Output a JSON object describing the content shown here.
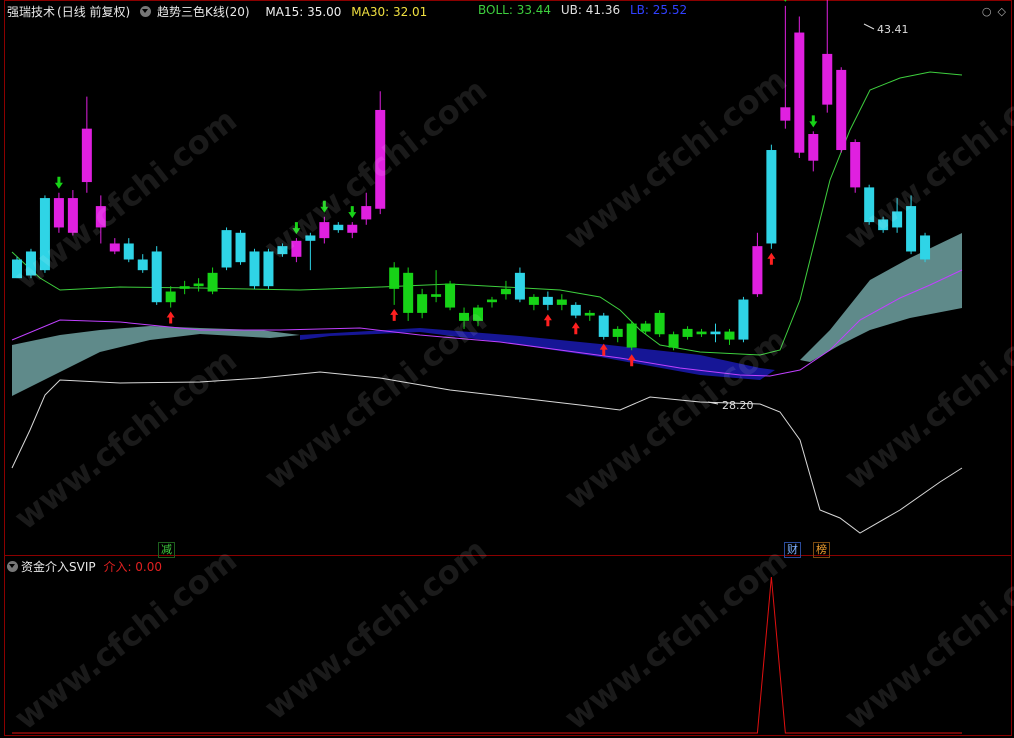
{
  "header": {
    "title": "强瑞技术",
    "period": "(日线 前复权)",
    "indicator": "趋势三色K线(20)",
    "ma15_label": "MA15: 35.00",
    "ma30_label": "MA30: 32.01"
  },
  "boll": {
    "boll_label": "BOLL: 33.44",
    "ub_label": "UB: 41.36",
    "lb_label": "LB: 25.52"
  },
  "window_icons": [
    "circle-icon",
    "diamond-icon"
  ],
  "annotations": {
    "high_label": "43.41",
    "low_label": "28.20"
  },
  "tags": {
    "reduce": "减",
    "finance": "财",
    "rank": "榜"
  },
  "sub_panel": {
    "title": "资金介入SVIP",
    "value_label": "介入: 0.00"
  },
  "watermark": "www.cfchi.com",
  "colors": {
    "up_cyan": "#2fd4e6",
    "bull_magenta": "#e020e0",
    "bear_green": "#17d317",
    "boll_upper": "#3ecf3e",
    "boll_lower": "#d8d8d8",
    "mid_line": "#c040ff",
    "band_fill": "#7fb8b8",
    "band_blue": "#1a1ab0",
    "signal_line": "#e01010"
  },
  "chart_data": {
    "type": "candlestick",
    "price_range": [
      20,
      45
    ],
    "candles": [
      {
        "o": 32.6,
        "c": 33.3,
        "h": 33.4,
        "l": 32.6,
        "col": "cyan"
      },
      {
        "o": 32.7,
        "c": 33.6,
        "h": 33.7,
        "l": 32.6,
        "col": "cyan"
      },
      {
        "o": 32.9,
        "c": 35.6,
        "h": 35.7,
        "l": 32.8,
        "col": "cyan"
      },
      {
        "o": 35.6,
        "c": 34.5,
        "h": 35.8,
        "l": 34.3,
        "col": "magenta"
      },
      {
        "o": 35.6,
        "c": 34.3,
        "h": 35.9,
        "l": 34.2,
        "col": "magenta"
      },
      {
        "o": 36.2,
        "c": 38.2,
        "h": 39.4,
        "l": 35.8,
        "col": "magenta"
      },
      {
        "o": 34.5,
        "c": 35.3,
        "h": 35.7,
        "l": 33.9,
        "col": "magenta"
      },
      {
        "o": 33.9,
        "c": 33.6,
        "h": 34.1,
        "l": 33.5,
        "col": "magenta"
      },
      {
        "o": 33.3,
        "c": 33.9,
        "h": 34.1,
        "l": 33.2,
        "col": "cyan"
      },
      {
        "o": 32.9,
        "c": 33.3,
        "h": 33.5,
        "l": 32.8,
        "col": "cyan"
      },
      {
        "o": 31.7,
        "c": 33.6,
        "h": 33.8,
        "l": 31.6,
        "col": "cyan"
      },
      {
        "o": 31.7,
        "c": 32.1,
        "h": 32.3,
        "l": 31.5,
        "col": "green"
      },
      {
        "o": 32.3,
        "c": 32.2,
        "h": 32.5,
        "l": 32.0,
        "col": "green"
      },
      {
        "o": 32.4,
        "c": 32.3,
        "h": 32.6,
        "l": 32.1,
        "col": "green"
      },
      {
        "o": 32.1,
        "c": 32.8,
        "h": 33.0,
        "l": 32.0,
        "col": "green"
      },
      {
        "o": 33.0,
        "c": 34.4,
        "h": 34.5,
        "l": 32.9,
        "col": "cyan"
      },
      {
        "o": 33.2,
        "c": 34.3,
        "h": 34.4,
        "l": 33.1,
        "col": "cyan"
      },
      {
        "o": 32.3,
        "c": 33.6,
        "h": 33.7,
        "l": 32.2,
        "col": "cyan"
      },
      {
        "o": 32.3,
        "c": 33.6,
        "h": 33.7,
        "l": 32.2,
        "col": "cyan"
      },
      {
        "o": 33.5,
        "c": 33.8,
        "h": 33.9,
        "l": 33.4,
        "col": "cyan"
      },
      {
        "o": 34.0,
        "c": 33.4,
        "h": 34.1,
        "l": 33.2,
        "col": "magenta"
      },
      {
        "o": 34.2,
        "c": 34.0,
        "h": 34.3,
        "l": 32.9,
        "col": "cyan"
      },
      {
        "o": 34.7,
        "c": 34.1,
        "h": 34.9,
        "l": 33.9,
        "col": "magenta"
      },
      {
        "o": 34.4,
        "c": 34.6,
        "h": 34.7,
        "l": 34.3,
        "col": "cyan"
      },
      {
        "o": 34.6,
        "c": 34.3,
        "h": 34.7,
        "l": 34.1,
        "col": "magenta"
      },
      {
        "o": 34.8,
        "c": 35.3,
        "h": 35.8,
        "l": 34.6,
        "col": "magenta"
      },
      {
        "o": 35.2,
        "c": 38.9,
        "h": 39.6,
        "l": 35.0,
        "col": "magenta"
      },
      {
        "o": 33.0,
        "c": 32.2,
        "h": 33.2,
        "l": 31.6,
        "col": "green"
      },
      {
        "o": 32.8,
        "c": 31.3,
        "h": 33.0,
        "l": 31.0,
        "col": "green"
      },
      {
        "o": 32.0,
        "c": 31.3,
        "h": 32.2,
        "l": 31.1,
        "col": "green"
      },
      {
        "o": 32.0,
        "c": 31.9,
        "h": 32.9,
        "l": 31.7,
        "col": "green"
      },
      {
        "o": 32.4,
        "c": 31.5,
        "h": 32.5,
        "l": 31.4,
        "col": "green"
      },
      {
        "o": 31.3,
        "c": 31.0,
        "h": 31.5,
        "l": 30.7,
        "col": "green"
      },
      {
        "o": 31.5,
        "c": 31.0,
        "h": 31.6,
        "l": 30.8,
        "col": "green"
      },
      {
        "o": 31.8,
        "c": 31.7,
        "h": 31.9,
        "l": 31.5,
        "col": "green"
      },
      {
        "o": 32.2,
        "c": 32.0,
        "h": 32.5,
        "l": 31.8,
        "col": "green"
      },
      {
        "o": 31.8,
        "c": 32.8,
        "h": 33.0,
        "l": 31.7,
        "col": "cyan"
      },
      {
        "o": 31.9,
        "c": 31.6,
        "h": 32.0,
        "l": 31.4,
        "col": "green"
      },
      {
        "o": 31.6,
        "c": 31.9,
        "h": 32.1,
        "l": 31.4,
        "col": "cyan"
      },
      {
        "o": 31.8,
        "c": 31.6,
        "h": 32.0,
        "l": 31.4,
        "col": "green"
      },
      {
        "o": 31.2,
        "c": 31.6,
        "h": 31.7,
        "l": 31.1,
        "col": "cyan"
      },
      {
        "o": 31.3,
        "c": 31.2,
        "h": 31.4,
        "l": 31.0,
        "col": "green"
      },
      {
        "o": 30.4,
        "c": 31.2,
        "h": 31.3,
        "l": 30.3,
        "col": "cyan"
      },
      {
        "o": 30.4,
        "c": 30.7,
        "h": 30.8,
        "l": 30.2,
        "col": "green"
      },
      {
        "o": 30.0,
        "c": 30.9,
        "h": 31.0,
        "l": 29.9,
        "col": "green"
      },
      {
        "o": 30.6,
        "c": 30.9,
        "h": 31.0,
        "l": 30.5,
        "col": "green"
      },
      {
        "o": 30.5,
        "c": 31.3,
        "h": 31.4,
        "l": 30.4,
        "col": "green"
      },
      {
        "o": 30.0,
        "c": 30.5,
        "h": 30.6,
        "l": 29.9,
        "col": "green"
      },
      {
        "o": 30.4,
        "c": 30.7,
        "h": 30.8,
        "l": 30.3,
        "col": "green"
      },
      {
        "o": 30.5,
        "c": 30.6,
        "h": 30.7,
        "l": 30.4,
        "col": "green"
      },
      {
        "o": 30.5,
        "c": 30.6,
        "h": 30.9,
        "l": 30.2,
        "col": "cyan"
      },
      {
        "o": 30.3,
        "c": 30.6,
        "h": 30.7,
        "l": 30.1,
        "col": "green"
      },
      {
        "o": 30.3,
        "c": 31.8,
        "h": 31.9,
        "l": 30.2,
        "col": "cyan"
      },
      {
        "o": 32.0,
        "c": 33.8,
        "h": 34.3,
        "l": 31.9,
        "col": "magenta"
      },
      {
        "o": 33.9,
        "c": 37.4,
        "h": 37.6,
        "l": 33.7,
        "col": "cyan"
      },
      {
        "o": 38.5,
        "c": 39.0,
        "h": 42.8,
        "l": 38.2,
        "col": "magenta"
      },
      {
        "o": 41.8,
        "c": 37.3,
        "h": 42.4,
        "l": 37.1,
        "col": "magenta"
      },
      {
        "o": 38.0,
        "c": 37.0,
        "h": 38.1,
        "l": 36.6,
        "col": "magenta"
      },
      {
        "o": 41.0,
        "c": 39.1,
        "h": 43.41,
        "l": 38.8,
        "col": "magenta"
      },
      {
        "o": 40.4,
        "c": 37.4,
        "h": 40.5,
        "l": 37.3,
        "col": "magenta"
      },
      {
        "o": 37.7,
        "c": 36.0,
        "h": 37.8,
        "l": 35.8,
        "col": "magenta"
      },
      {
        "o": 36.0,
        "c": 34.7,
        "h": 36.1,
        "l": 34.6,
        "col": "cyan"
      },
      {
        "o": 34.8,
        "c": 34.4,
        "h": 34.9,
        "l": 34.3,
        "col": "cyan"
      },
      {
        "o": 35.1,
        "c": 34.5,
        "h": 35.6,
        "l": 34.3,
        "col": "cyan"
      },
      {
        "o": 35.3,
        "c": 33.6,
        "h": 35.7,
        "l": 33.5,
        "col": "cyan"
      },
      {
        "o": 34.2,
        "c": 33.3,
        "h": 34.3,
        "l": 33.2,
        "col": "cyan"
      }
    ],
    "annotations": [
      {
        "text": "43.41",
        "value": 43.41
      },
      {
        "text": "28.20",
        "value": 28.2
      }
    ],
    "signal_series": {
      "name": "介入",
      "values": [
        0,
        0,
        0,
        0,
        0,
        0,
        0,
        0,
        0,
        0,
        0,
        0,
        0,
        0,
        0,
        0,
        0,
        0,
        0,
        0,
        0,
        0,
        0,
        0,
        0,
        0,
        0,
        0,
        0,
        0,
        0,
        0,
        0,
        0,
        0,
        0,
        0,
        0,
        0,
        0,
        0,
        0,
        0,
        0,
        0,
        0,
        0,
        0,
        0,
        0,
        0,
        0,
        0,
        0,
        1,
        0,
        0,
        0,
        0,
        0,
        0,
        0,
        0,
        0,
        0,
        0
      ]
    }
  }
}
